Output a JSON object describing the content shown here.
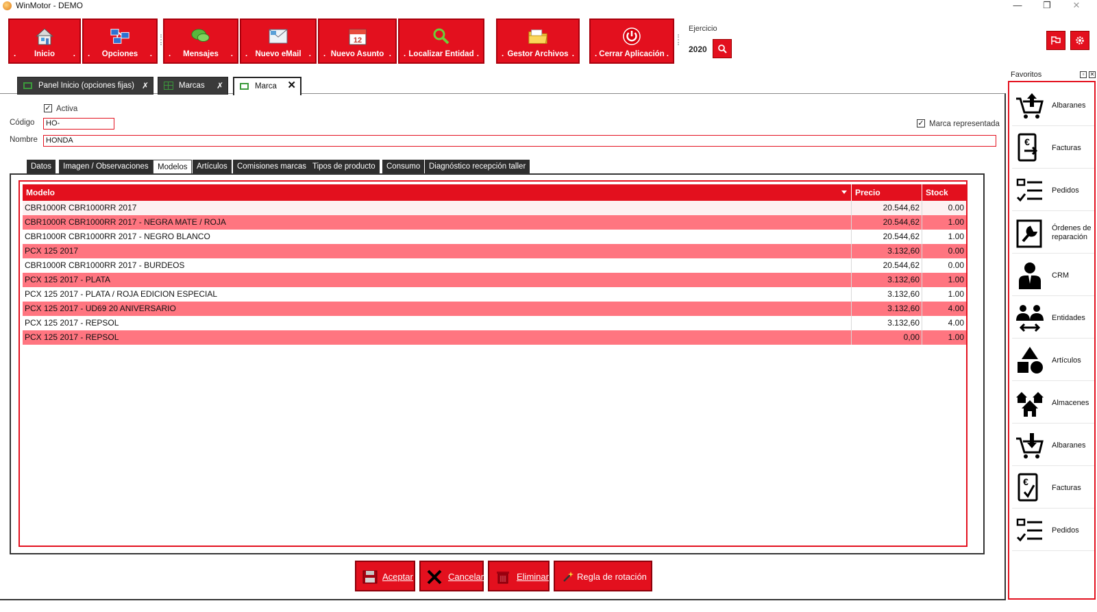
{
  "window": {
    "title": "WinMotor - DEMO",
    "controls": {
      "minimize": "—",
      "restore": "❐",
      "close": "✕"
    }
  },
  "toolbar": {
    "buttons": [
      {
        "label": "Inicio",
        "icon": "home-icon"
      },
      {
        "label": "Opciones",
        "icon": "options-icon"
      },
      {
        "label": "Mensajes",
        "icon": "chat-bubbles-icon"
      },
      {
        "label": "Nuevo eMail",
        "icon": "new-email-icon"
      },
      {
        "label": "Nuevo Asunto",
        "icon": "calendar-icon"
      },
      {
        "label": "Localizar Entidad",
        "icon": "search-icon"
      },
      {
        "label": "Gestor Archivos",
        "icon": "folder-icon"
      },
      {
        "label": "Cerrar Aplicación",
        "icon": "power-icon"
      }
    ],
    "dot": ".",
    "ejercicio_label": "Ejercicio",
    "ejercicio_value": "2020"
  },
  "doc_tabs": [
    {
      "label": "Panel Inicio (opciones fijas)",
      "pin": "✗"
    },
    {
      "label": "Marcas",
      "pin": "✗"
    },
    {
      "label": "Marca",
      "close": "✕"
    }
  ],
  "form": {
    "activa_label": "Activa",
    "activa_checked": "✓",
    "codigo_label": "Código",
    "codigo_value": "HO-",
    "nombre_label": "Nombre",
    "nombre_value": "HONDA",
    "marca_rep_label": "Marca representada",
    "marca_rep_checked": "✓"
  },
  "inner_tabs": [
    "Datos",
    "Imagen / Observaciones",
    "Modelos",
    "Artículos",
    "Comisiones marcas",
    "Tipos de  producto",
    "Consumo",
    "Diagnóstico recepción taller"
  ],
  "grid": {
    "columns": [
      "Modelo",
      "Precio",
      "Stock"
    ],
    "rows": [
      {
        "modelo": "CBR1000R CBR1000RR 2017",
        "precio": "20.544,62",
        "stock": "0.00"
      },
      {
        "modelo": "CBR1000R CBR1000RR 2017 - NEGRA MATE / ROJA",
        "precio": "20.544,62",
        "stock": "1.00"
      },
      {
        "modelo": "CBR1000R CBR1000RR 2017 - NEGRO BLANCO",
        "precio": "20.544,62",
        "stock": "1.00"
      },
      {
        "modelo": "PCX 125 2017",
        "precio": "3.132,60",
        "stock": "0.00"
      },
      {
        "modelo": "CBR1000R CBR1000RR 2017 - BURDEOS",
        "precio": "20.544,62",
        "stock": "0.00"
      },
      {
        "modelo": "PCX 125 2017 - PLATA",
        "precio": "3.132,60",
        "stock": "1.00"
      },
      {
        "modelo": "PCX 125 2017 - PLATA / ROJA EDICION ESPECIAL",
        "precio": "3.132,60",
        "stock": "1.00"
      },
      {
        "modelo": "PCX 125 2017 - UD69 20 ANIVERSARIO",
        "precio": "3.132,60",
        "stock": "4.00"
      },
      {
        "modelo": "PCX 125 2017 - REPSOL",
        "precio": "3.132,60",
        "stock": "4.00"
      },
      {
        "modelo": "PCX 125 2017 - REPSOL",
        "precio": "0,00",
        "stock": "1.00"
      }
    ]
  },
  "actions": {
    "aceptar": "Aceptar",
    "cancelar": "Cancelar",
    "eliminar": "Eliminar",
    "regla": "Regla de rotación"
  },
  "favorites": {
    "title": "Favoritos",
    "items": [
      {
        "label": "Albaranes",
        "icon": "cart-upload-icon"
      },
      {
        "label": "Facturas",
        "icon": "invoice-out-icon"
      },
      {
        "label": "Pedidos",
        "icon": "checklist-icon"
      },
      {
        "label": "Órdenes de reparación",
        "icon": "wrench-document-icon"
      },
      {
        "label": "CRM",
        "icon": "person-suit-icon"
      },
      {
        "label": "Entidades",
        "icon": "people-exchange-icon"
      },
      {
        "label": "Artículos",
        "icon": "shapes-icon"
      },
      {
        "label": "Almacenes",
        "icon": "warehouses-icon"
      },
      {
        "label": "Albaranes",
        "icon": "cart-download-icon"
      },
      {
        "label": "Facturas",
        "icon": "invoice-check-icon"
      },
      {
        "label": "Pedidos",
        "icon": "checklist-icon"
      }
    ]
  },
  "colors": {
    "accent": "#e3101e",
    "row_alt": "#ff7580",
    "dark_tab": "#3a3a3a"
  }
}
